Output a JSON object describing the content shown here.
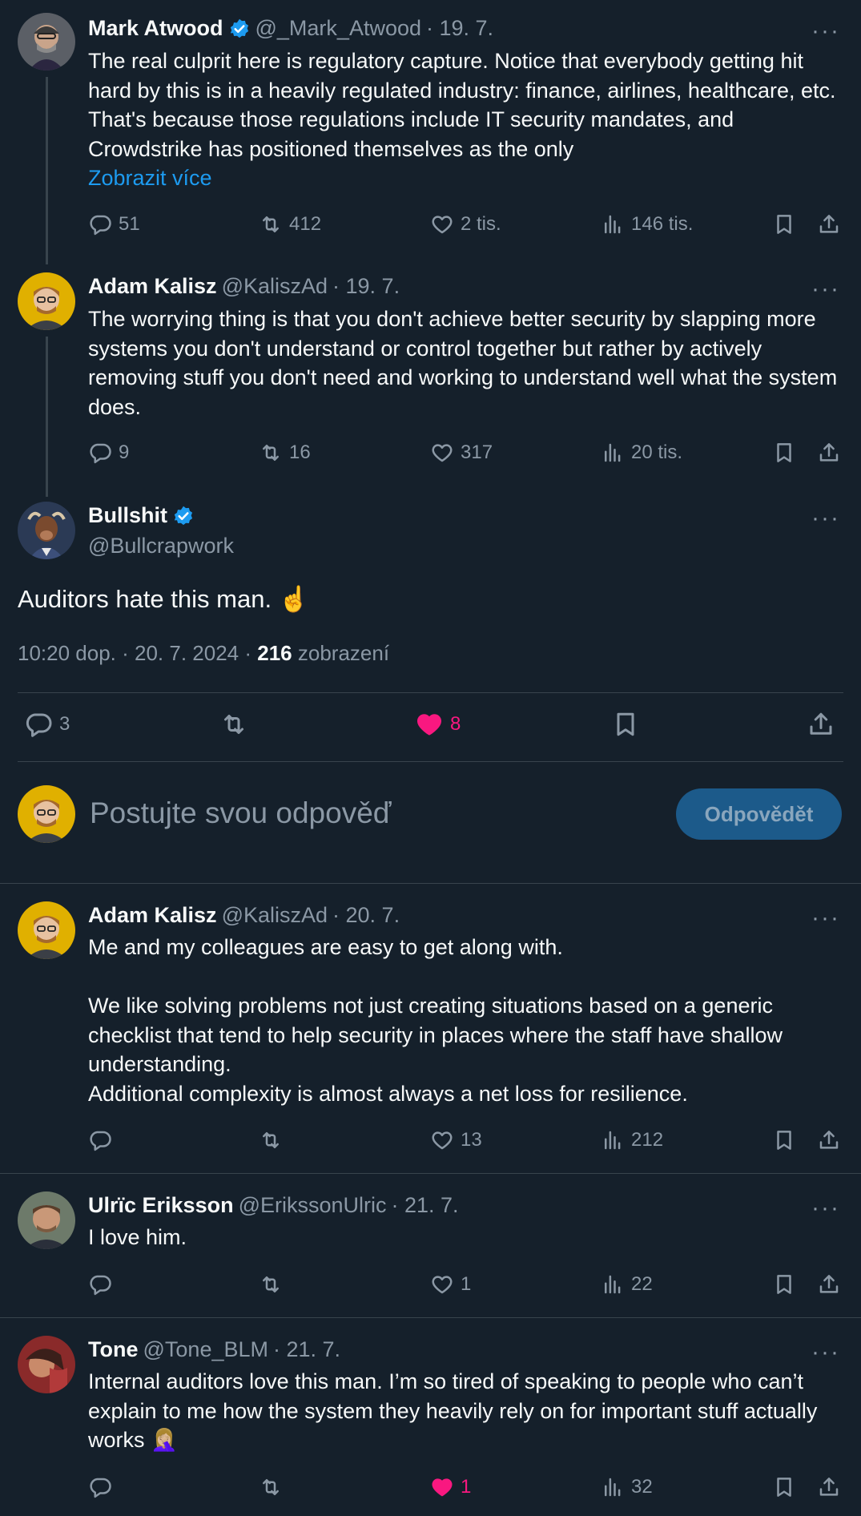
{
  "tweets": [
    {
      "name": "Mark Atwood",
      "handle": "@_Mark_Atwood",
      "date": "· 19. 7.",
      "text": "The real culprit here is regulatory capture. Notice that everybody getting hit hard by this is in a heavily regulated industry: finance, airlines, healthcare, etc. That's because those regulations include IT security mandates, and Crowdstrike has positioned themselves as the only",
      "show_more": "Zobrazit více",
      "replies": "51",
      "reposts": "412",
      "likes": "2 tis.",
      "views": "146 tis."
    },
    {
      "name": "Adam Kalisz",
      "handle": "@KaliszAd",
      "date": "· 19. 7.",
      "text": "The worrying thing is that you don't achieve better security by slapping more systems you don't understand or control together but rather by actively removing stuff you don't need and working to understand well what the system does.",
      "replies": "9",
      "reposts": "16",
      "likes": "317",
      "views": "20 tis."
    }
  ],
  "main": {
    "name": "Bullshit",
    "handle": "@Bullcrapwork",
    "text": "Auditors hate this man.",
    "emoji": "☝️",
    "time": "10:20 dop. · 20. 7. 2024 ·",
    "views_count": "216",
    "views_label": "zobrazení",
    "replies": "3",
    "likes": "8"
  },
  "composer": {
    "placeholder": "Postujte svou odpověď",
    "button": "Odpovědět"
  },
  "replies": [
    {
      "name": "Adam Kalisz",
      "handle": "@KaliszAd",
      "date": "· 20. 7.",
      "p1": "Me and my colleagues are easy to get along with.",
      "p2": "We like solving problems not just creating situations based on a generic checklist that tend to help security in places where the staff have shallow understanding.",
      "p3": "Additional complexity is almost always a net loss for resilience.",
      "likes": "13",
      "views": "212"
    },
    {
      "name": "Ulrïc Eriksson",
      "handle": "@ErikssonUlric",
      "date": "· 21. 7.",
      "text": "I love him.",
      "likes": "1",
      "views": "22"
    },
    {
      "name": "Tone",
      "handle": "@Tone_BLM",
      "date": "· 21. 7.",
      "text": "Internal auditors love this man. I’m so tired of speaking to people who can’t explain to me how the system they heavily rely on for important stuff actually works",
      "emoji": "🤦🏼‍♀️",
      "likes": "1",
      "views": "32"
    }
  ],
  "more_dots": "···",
  "colors": {
    "bg": "#15202b",
    "accent": "#1d9bf0",
    "like": "#f91880",
    "muted": "#8b98a5",
    "border": "#38444d"
  },
  "icons": [
    "reply-icon",
    "repost-icon",
    "like-icon",
    "views-icon",
    "bookmark-icon",
    "share-icon",
    "verified-badge-icon",
    "more-icon"
  ]
}
